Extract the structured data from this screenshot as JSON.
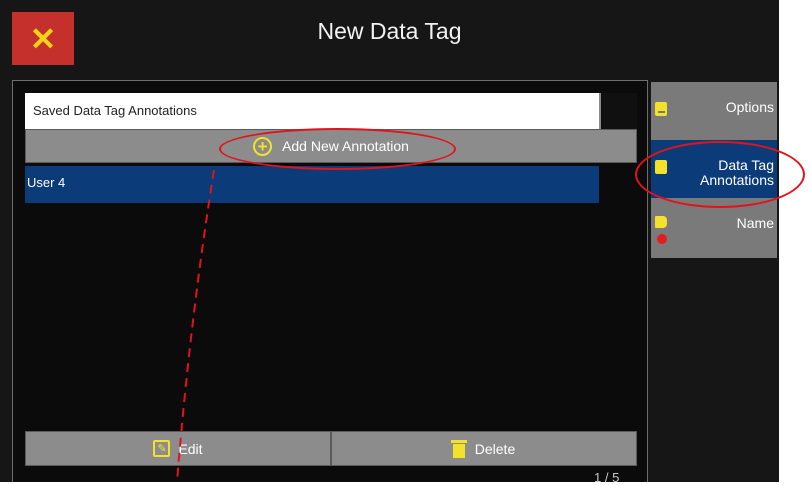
{
  "header": {
    "close_label": "✕",
    "title": "New Data Tag"
  },
  "list": {
    "header_label": "Saved Data Tag Annotations",
    "add_button_label": "Add New Annotation",
    "items": [
      {
        "label": "User 4",
        "selected": true
      }
    ]
  },
  "actions": {
    "edit_label": "Edit",
    "delete_label": "Delete"
  },
  "pagination": {
    "indicator": "1 / 5"
  },
  "sidebar": {
    "items": [
      {
        "label": "Options"
      },
      {
        "label_line1": "Data Tag",
        "label_line2": "Annotations",
        "selected": true
      },
      {
        "label": "Name"
      }
    ]
  },
  "colors": {
    "accent_yellow": "#f3e12a",
    "selected_blue": "#0b3b78",
    "close_red": "#c6302c",
    "highlight_red": "#e0141a"
  }
}
